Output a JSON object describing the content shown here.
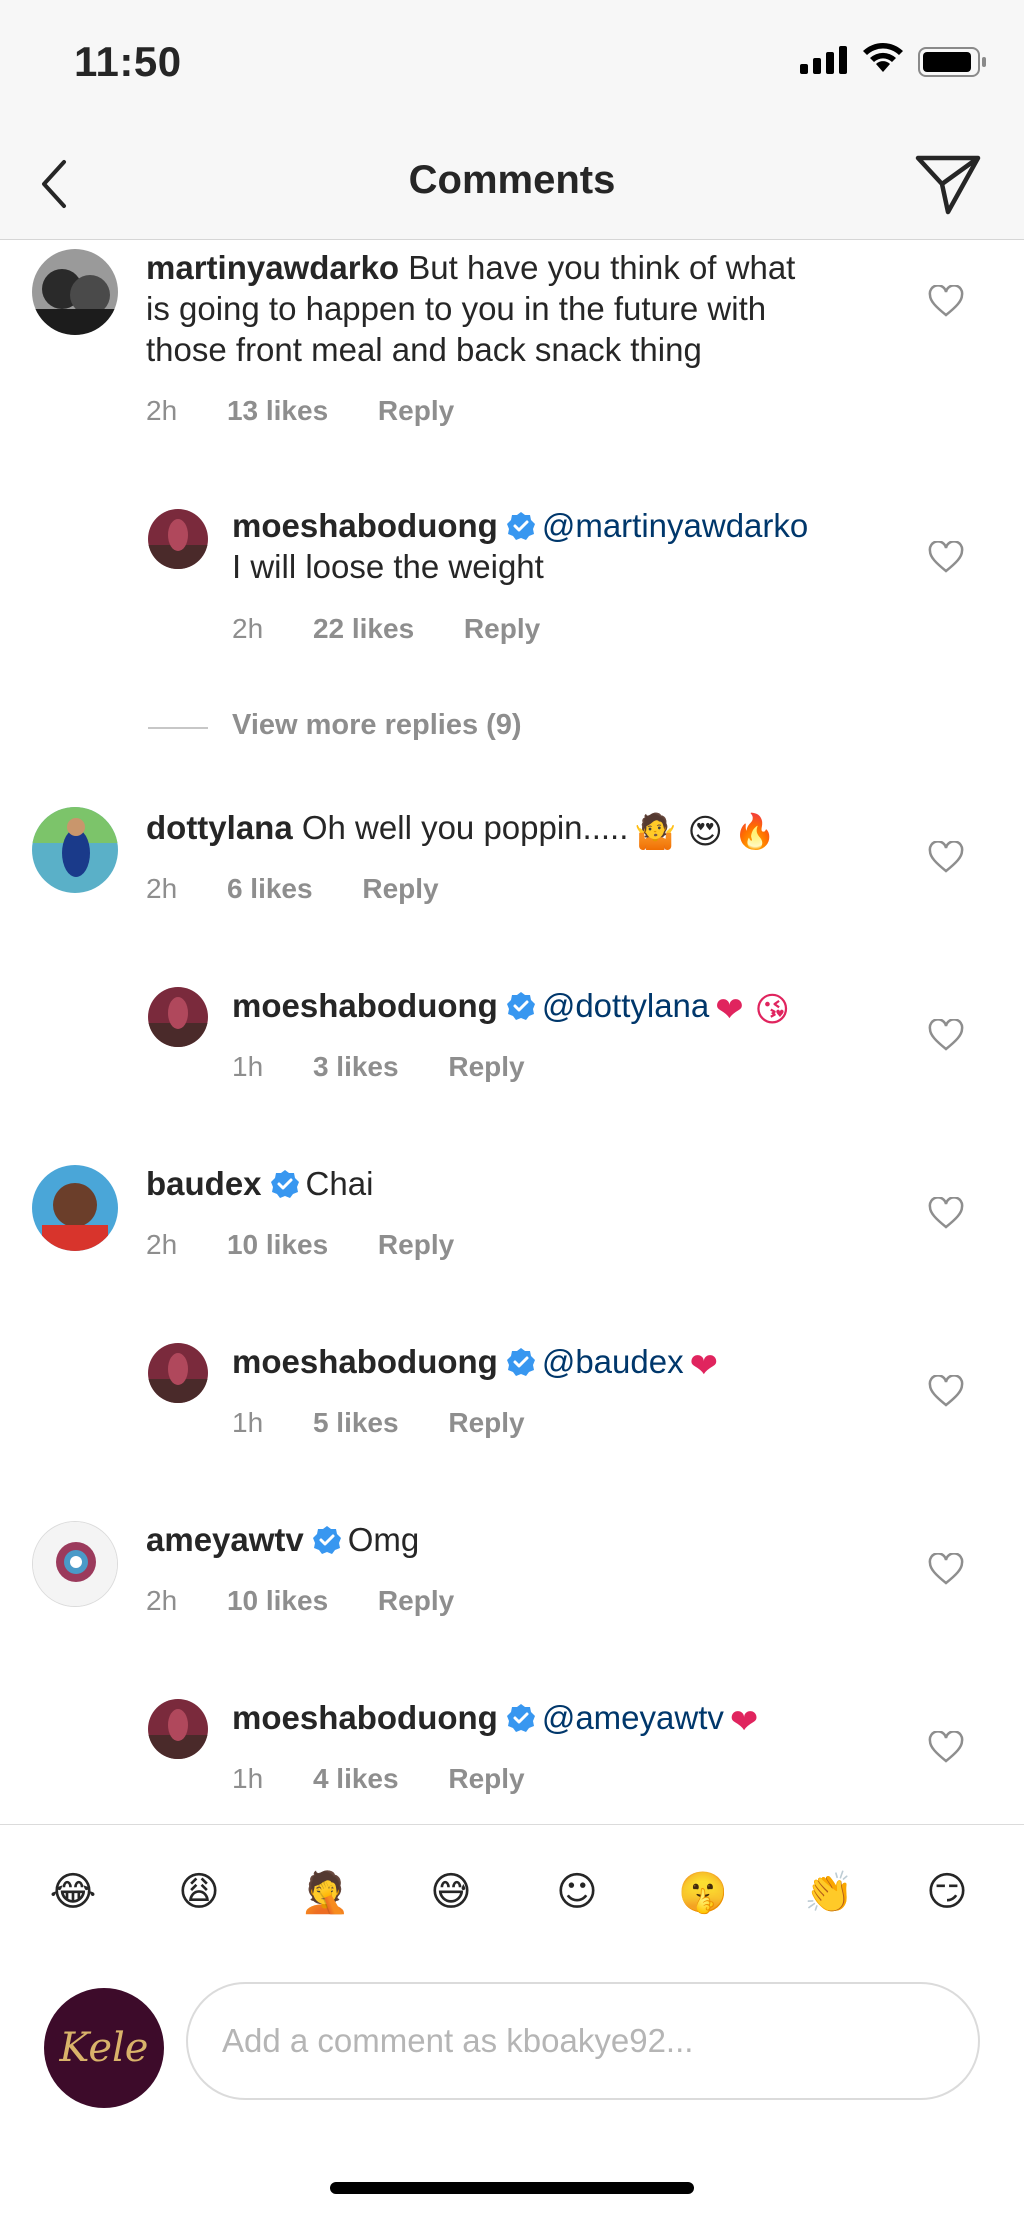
{
  "status_bar": {
    "time": "11:50"
  },
  "nav": {
    "title": "Comments"
  },
  "comments": [
    {
      "username": "martinyawdarko",
      "lines": [
        "But have you think of what",
        "is going to happen to you in the future with",
        "those front meal and back snack thing"
      ],
      "age": "2h",
      "likes": "13 likes",
      "reply": "Reply"
    },
    {
      "username": "moeshaboduong",
      "mention": "@martinyawdarko",
      "text": "I will loose the weight",
      "age": "2h",
      "likes": "22 likes",
      "reply": "Reply"
    },
    {
      "view_more": "View more replies (9)"
    },
    {
      "username": "dottylana",
      "text": "Oh well you poppin.....",
      "emojis": "🤷 😍 🔥",
      "age": "2h",
      "likes": "6 likes",
      "reply": "Reply"
    },
    {
      "username": "moeshaboduong",
      "mention": "@dottylana",
      "emojis": "❤ 😘",
      "age": "1h",
      "likes": "3 likes",
      "reply": "Reply"
    },
    {
      "username": "baudex",
      "text": "Chai",
      "age": "2h",
      "likes": "10 likes",
      "reply": "Reply"
    },
    {
      "username": "moeshaboduong",
      "mention": "@baudex",
      "emojis": "❤",
      "age": "1h",
      "likes": "5 likes",
      "reply": "Reply"
    },
    {
      "username": "ameyawtv",
      "text": "Omg",
      "age": "2h",
      "likes": "10 likes",
      "reply": "Reply"
    },
    {
      "username": "moeshaboduong",
      "mention": "@ameyawtv",
      "emojis": "❤",
      "age": "1h",
      "likes": "4 likes",
      "reply": "Reply"
    }
  ],
  "emoji_bar": [
    "😂",
    "😩",
    "🤦",
    "😅",
    "☺",
    "🤫",
    "👏",
    "😏"
  ],
  "input": {
    "avatar_text": "Kele",
    "placeholder": "Add a comment as kboakye92..."
  },
  "colors": {
    "mention": "#00376b",
    "verified": "#3897f0",
    "meta": "#8e8e8e"
  }
}
